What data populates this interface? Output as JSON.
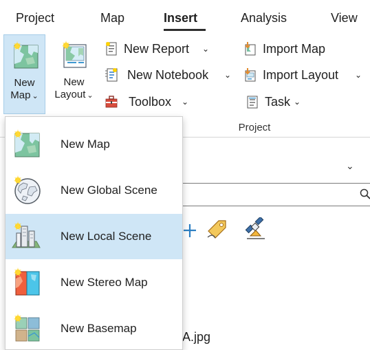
{
  "ribbon": {
    "tabs": [
      {
        "label": "Project",
        "active": false
      },
      {
        "label": "Map",
        "active": false
      },
      {
        "label": "Insert",
        "active": true
      },
      {
        "label": "Analysis",
        "active": false
      },
      {
        "label": "View",
        "active": false
      }
    ],
    "buttons": {
      "new_map": {
        "line1": "New",
        "line2": "Map",
        "icon": "new-map-icon"
      },
      "new_layout": {
        "line1": "New",
        "line2": "Layout",
        "icon": "new-layout-icon"
      },
      "new_report": {
        "label": "New Report",
        "icon": "report-icon"
      },
      "new_notebook": {
        "label": "New Notebook",
        "icon": "notebook-icon"
      },
      "toolbox": {
        "label": "Toolbox",
        "icon": "toolbox-icon"
      },
      "import_map": {
        "label": "Import Map",
        "icon": "import-map-icon"
      },
      "import_layout": {
        "label": "Import Layout",
        "icon": "import-layout-icon"
      },
      "task": {
        "label": "Task",
        "icon": "task-icon"
      }
    },
    "group_label": "Project"
  },
  "dropdown": {
    "items": [
      {
        "label": "New Map",
        "icon": "new-map-icon",
        "selected": false
      },
      {
        "label": "New Global Scene",
        "icon": "globe-icon",
        "selected": false
      },
      {
        "label": "New Local Scene",
        "icon": "local-scene-icon",
        "selected": true
      },
      {
        "label": "New Stereo Map",
        "icon": "stereo-map-icon",
        "selected": false
      },
      {
        "label": "New Basemap",
        "icon": "basemap-icon",
        "selected": false
      }
    ]
  },
  "background_panel": {
    "file_text": "A.jpg",
    "colors": {
      "accent": "#cfe6f6",
      "accent_border": "#a6cde8"
    }
  }
}
